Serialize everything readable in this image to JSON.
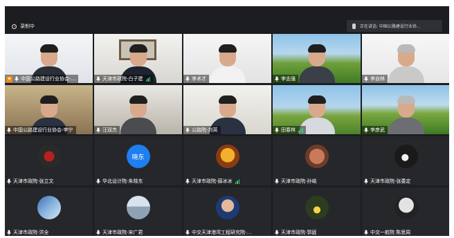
{
  "header": {
    "recording_label": "录制中",
    "speaking_label": "正在讲话: 中国公路建设行业协..."
  },
  "participants": [
    {
      "name": "中国公路建设行业协会-...",
      "host": true,
      "signal": false
    },
    {
      "name": "天津市政院-白子建",
      "signal": true
    },
    {
      "name": "李术才",
      "signal": false
    },
    {
      "name": "李志强",
      "signal": false
    },
    {
      "name": "李自林",
      "signal": false
    },
    {
      "name": "中国公路建设行业协会-李宁",
      "signal": false
    },
    {
      "name": "汪双杰",
      "signal": false
    },
    {
      "name": "公路院-刘英",
      "signal": false
    },
    {
      "name": "田春林",
      "signal": true
    },
    {
      "name": "李彦武",
      "signal": false
    },
    {
      "name": "天津市政院-张立文",
      "signal": false
    },
    {
      "name": "华北设计院-朱晓东",
      "signal": false,
      "avatar_text": "晓东"
    },
    {
      "name": "天津市政院-薛冰冰",
      "signal": true
    },
    {
      "name": "天津市政院-孙峣",
      "signal": false
    },
    {
      "name": "天津市政院-张委定",
      "signal": false
    },
    {
      "name": "天津市政院-洪全",
      "signal": false
    },
    {
      "name": "天津市政院-宋广君",
      "signal": false
    },
    {
      "name": "中交天津港湾工程研究院-...",
      "signal": false
    },
    {
      "name": "天津市政院-郭庭",
      "signal": false
    },
    {
      "name": "中交一航院 陈思周",
      "signal": false
    }
  ],
  "colors": {
    "mic_icon": "#ffffff",
    "signal": "#37d06a",
    "host_badge": "#f28c18",
    "avatar_text_bg": "#1f7ef0",
    "dark_bg": "#1c1d20"
  },
  "icons": {
    "recording": "record-icon",
    "speaker": "microphone-icon",
    "host": "host-icon",
    "signal": "signal-bars-icon"
  }
}
